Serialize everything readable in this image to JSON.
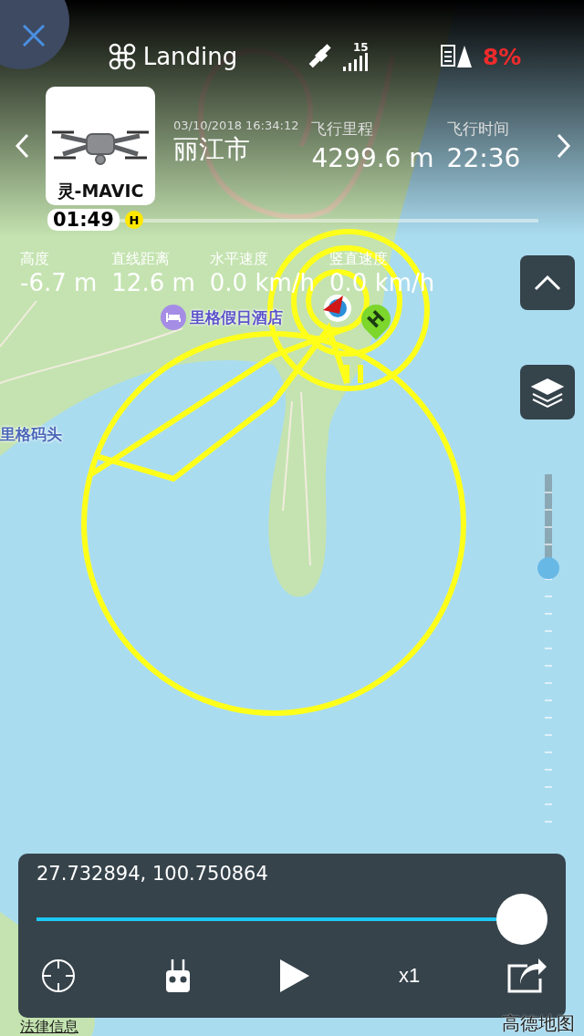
{
  "status_bar": {
    "flight_mode": "Landing",
    "satellite_count": "15",
    "battery": "8%"
  },
  "flight_card": {
    "aircraft": "灵-MAVIC",
    "time": "01:49",
    "home_marker": "H",
    "date": "03/10/2018 16:34:12",
    "city": "丽江市",
    "stats": [
      {
        "label": "飞行里程",
        "value": "4299.6 m"
      },
      {
        "label": "飞行时间",
        "value": "22:36"
      }
    ],
    "timeline": {
      "level": 0.02
    }
  },
  "telemetry": [
    {
      "label": "高度",
      "value": "-6.7 m"
    },
    {
      "label": "直线距离",
      "value": "12.6 m"
    },
    {
      "label": "水平速度",
      "value": "0.0 km/h"
    },
    {
      "label": "竖直速度",
      "value": "0.0 km/h"
    }
  ],
  "map": {
    "home_pin": "H",
    "labels": [
      {
        "text": "里格假日酒店",
        "kind": "hotel"
      },
      {
        "text": "里格码头",
        "kind": "place"
      }
    ],
    "legal_link": "法律信息",
    "attribution": "高德地图"
  },
  "zoom_slider": {
    "level": 0.25
  },
  "playback": {
    "coordinates": "27.732894, 100.750864",
    "level": 1,
    "speed": "x1"
  }
}
